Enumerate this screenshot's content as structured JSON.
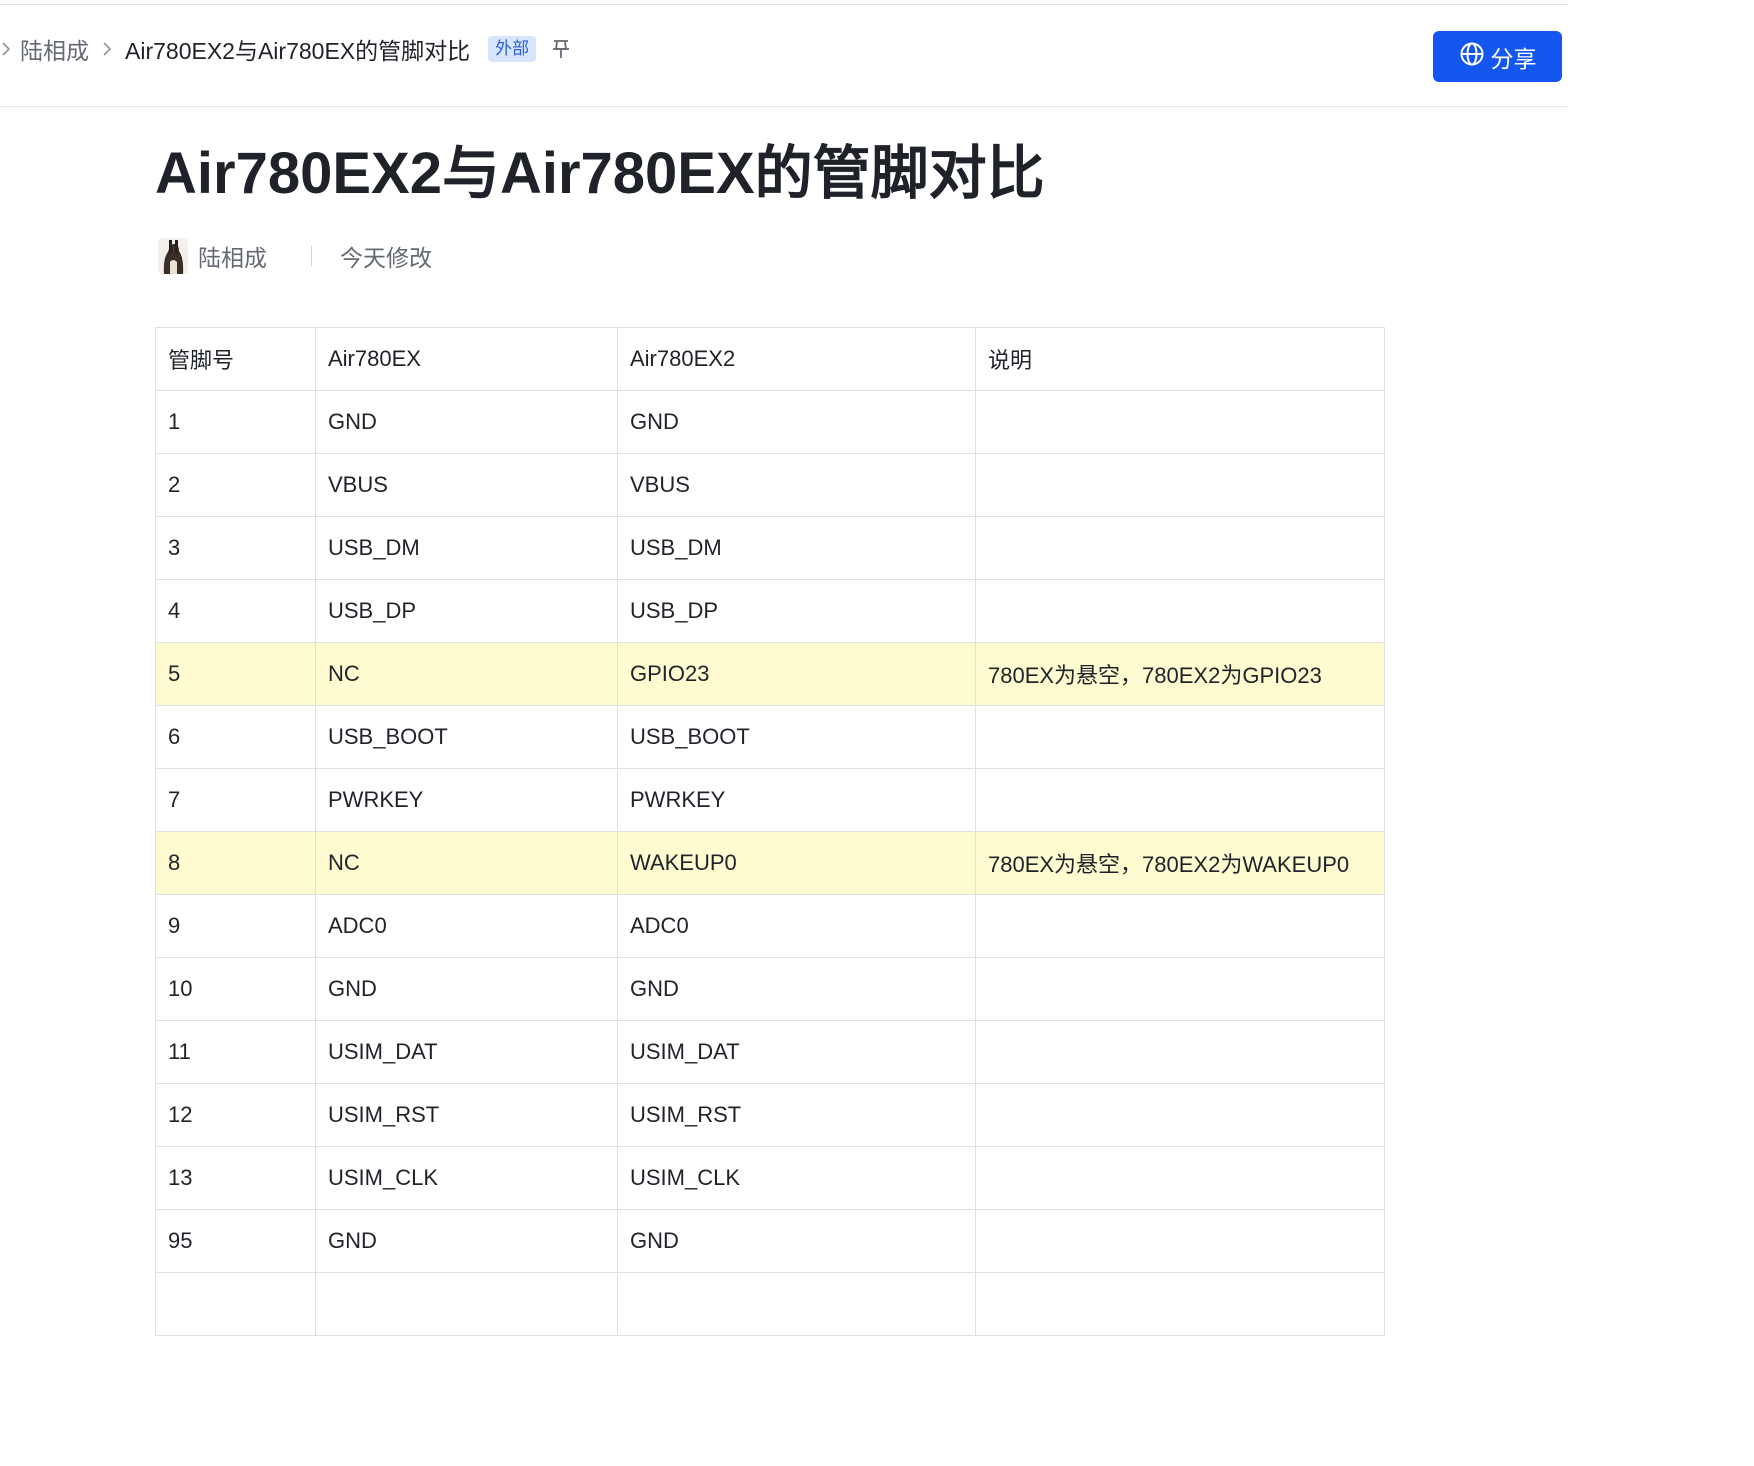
{
  "breadcrumb": {
    "parent": "陆相成",
    "current": "Air780EX2与Air780EX的管脚对比",
    "badge": "外部"
  },
  "header": {
    "share_label": "分享"
  },
  "doc": {
    "title": "Air780EX2与Air780EX的管脚对比",
    "author": "陆相成",
    "modified": "今天修改"
  },
  "table": {
    "headers": [
      "管脚号",
      "Air780EX",
      "Air780EX2",
      "说明"
    ],
    "rows": [
      {
        "cells": [
          "1",
          "GND",
          "GND",
          ""
        ],
        "highlight": false
      },
      {
        "cells": [
          "2",
          "VBUS",
          "VBUS",
          ""
        ],
        "highlight": false
      },
      {
        "cells": [
          "3",
          "USB_DM",
          "USB_DM",
          ""
        ],
        "highlight": false
      },
      {
        "cells": [
          "4",
          "USB_DP",
          "USB_DP",
          ""
        ],
        "highlight": false
      },
      {
        "cells": [
          "5",
          "NC",
          "GPIO23",
          "780EX为悬空，780EX2为GPIO23"
        ],
        "highlight": true
      },
      {
        "cells": [
          "6",
          "USB_BOOT",
          "USB_BOOT",
          ""
        ],
        "highlight": false
      },
      {
        "cells": [
          "7",
          "PWRKEY",
          "PWRKEY",
          ""
        ],
        "highlight": false
      },
      {
        "cells": [
          "8",
          "NC",
          "WAKEUP0",
          "780EX为悬空，780EX2为WAKEUP0"
        ],
        "highlight": true
      },
      {
        "cells": [
          "9",
          "ADC0",
          "ADC0",
          ""
        ],
        "highlight": false
      },
      {
        "cells": [
          "10",
          "GND",
          "GND",
          ""
        ],
        "highlight": false
      },
      {
        "cells": [
          "11",
          "USIM_DAT",
          "USIM_DAT",
          ""
        ],
        "highlight": false
      },
      {
        "cells": [
          "12",
          "USIM_RST",
          "USIM_RST",
          ""
        ],
        "highlight": false
      },
      {
        "cells": [
          "13",
          "USIM_CLK",
          "USIM_CLK",
          ""
        ],
        "highlight": false
      },
      {
        "cells": [
          "95",
          "GND",
          "GND",
          ""
        ],
        "highlight": false
      }
    ]
  },
  "colors": {
    "accent": "#1456f0",
    "highlight_row": "#fefbd1",
    "badge_bg": "#d7e4fd"
  },
  "icons": [
    "chevron-right-icon",
    "pin-icon",
    "globe-icon",
    "avatar"
  ]
}
